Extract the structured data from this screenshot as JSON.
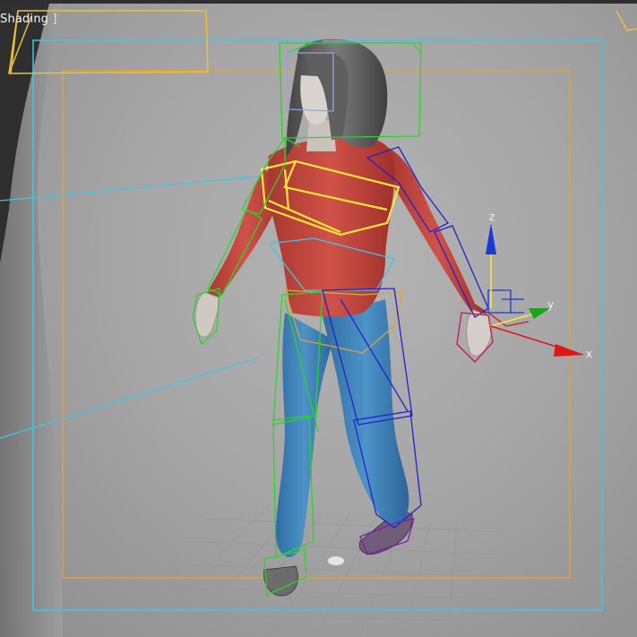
{
  "viewport": {
    "label": "Shading ]",
    "colors": {
      "background": "#a9a9a9",
      "safe_frame_outer": "#3fc6e6",
      "safe_frame_inner": "#e0a23a",
      "selection": "#ffe838",
      "bones_left": "#2bd42b",
      "bones_right": "#2222cc",
      "sweater": "#c9473f",
      "jeans": "#3f82b8",
      "hair": "#5a5a5a",
      "skin": "#cfc9c2"
    }
  },
  "gizmo": {
    "axis_x_label": "x",
    "axis_y_label": "y",
    "axis_z_label": "z",
    "colors": {
      "x": "#e01515",
      "y": "#1aa51a",
      "z": "#1a3ad8"
    }
  }
}
